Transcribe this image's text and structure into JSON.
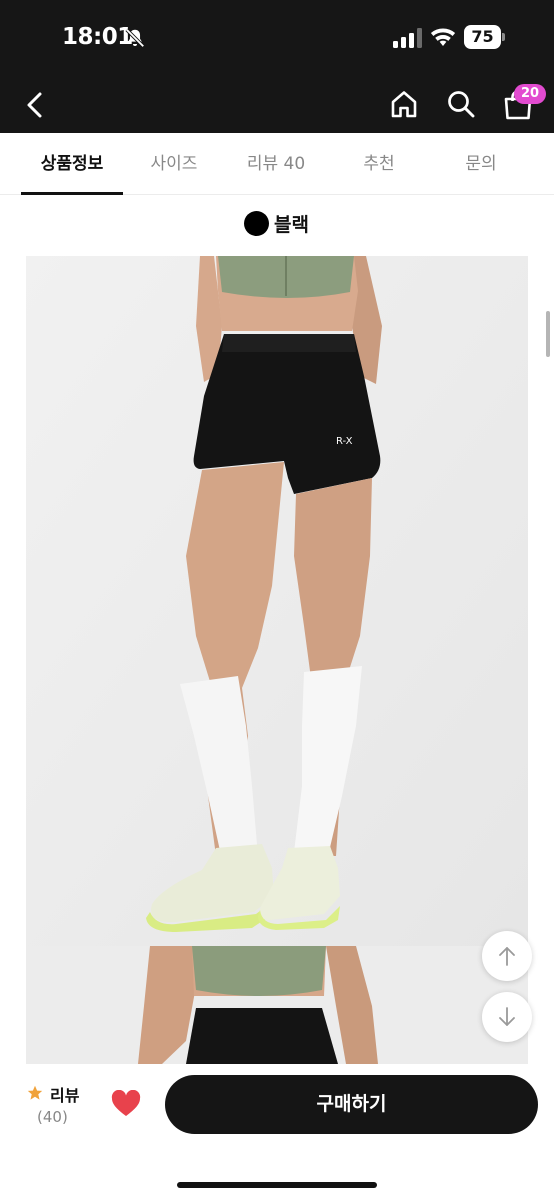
{
  "status_bar": {
    "time": "18:01",
    "battery": "75",
    "mute_icon": "bell-slash-icon",
    "signal_icon": "cellular-signal-icon",
    "wifi_icon": "wifi-icon"
  },
  "header": {
    "back_icon": "chevron-left-icon",
    "home_icon": "home-icon",
    "search_icon": "search-icon",
    "cart_icon": "shopping-bag-icon",
    "cart_badge": "20",
    "badge_color": "#e24bd0"
  },
  "tabs": [
    {
      "label": "상품정보",
      "active": true
    },
    {
      "label": "사이즈",
      "active": false
    },
    {
      "label": "리뷰 40",
      "active": false
    },
    {
      "label": "추천",
      "active": false
    },
    {
      "label": "문의",
      "active": false
    }
  ],
  "product": {
    "color_name": "블랙",
    "color_swatch": "#000000",
    "shorts_logo": "R-X"
  },
  "floating_buttons": {
    "up_icon": "arrow-up-icon",
    "down_icon": "arrow-down-icon"
  },
  "bottom_bar": {
    "review_label": "리뷰",
    "review_count": "(40)",
    "star_color": "#f0a23a",
    "heart_color": "#e8424c",
    "buy_label": "구매하기"
  }
}
